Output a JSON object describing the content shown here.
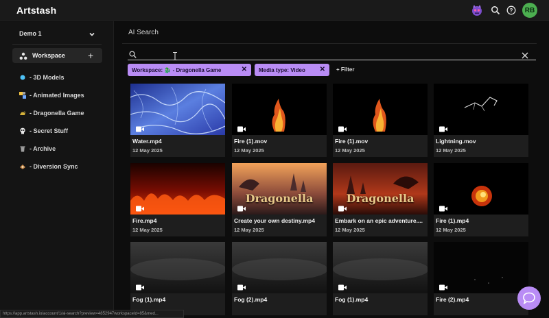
{
  "app": {
    "title": "Artstash",
    "avatar_initials": "RB",
    "brand_color": "#b98cf5"
  },
  "header_icons": [
    "mascot-icon",
    "search-icon",
    "help-icon"
  ],
  "sidebar": {
    "workspace_selector": "Demo 1",
    "workspace_row": "Workspace",
    "items": [
      {
        "label": "- 3D Models",
        "icon": "blue-dot-icon"
      },
      {
        "label": "- Animated Images",
        "icon": "tiles-icon"
      },
      {
        "label": "- Dragonella Game",
        "icon": "dragon-icon"
      },
      {
        "label": "- Secret Stuff",
        "icon": "skull-icon"
      },
      {
        "label": "- Archive",
        "icon": "trash-icon"
      },
      {
        "label": "- Diversion Sync",
        "icon": "sync-icon"
      }
    ]
  },
  "main": {
    "title": "AI Search",
    "search": {
      "value": "",
      "placeholder": ""
    },
    "filters": [
      {
        "label": "Workspace: 🐉 - Dragonella Game"
      },
      {
        "label": "Media type: Video"
      }
    ],
    "add_filter": "+ Filter",
    "cards": [
      {
        "name": "Water.mp4",
        "date": "12 May 2025",
        "thumb": "water"
      },
      {
        "name": "Fire (1).mov",
        "date": "12 May 2025",
        "thumb": "fire-small"
      },
      {
        "name": "Fire (1).mov",
        "date": "12 May 2025",
        "thumb": "fire-small"
      },
      {
        "name": "Lightning.mov",
        "date": "12 May 2025",
        "thumb": "lightning"
      },
      {
        "name": "Fire.mp4",
        "date": "12 May 2025",
        "thumb": "fire-wall"
      },
      {
        "name": "Create your own destiny.mp4",
        "date": "12 May 2025",
        "thumb": "dragonella",
        "overlay": "Dragonella"
      },
      {
        "name": "Embark on an epic adventure....",
        "date": "12 May 2025",
        "thumb": "dragonella-red",
        "overlay": "Dragonella"
      },
      {
        "name": "Fire (1).mp4",
        "date": "12 May 2025",
        "thumb": "fireball"
      },
      {
        "name": "Fog (1).mp4",
        "date": "",
        "thumb": "fog"
      },
      {
        "name": "Fog (2).mp4",
        "date": "",
        "thumb": "fog"
      },
      {
        "name": "Fog (1).mp4",
        "date": "",
        "thumb": "fog"
      },
      {
        "name": "Fire (2).mp4",
        "date": "",
        "thumb": "dark"
      }
    ]
  },
  "status_url": "https://app.artstash.io/account/1/ai-search?preview=4852947workspaceId=85&med..."
}
